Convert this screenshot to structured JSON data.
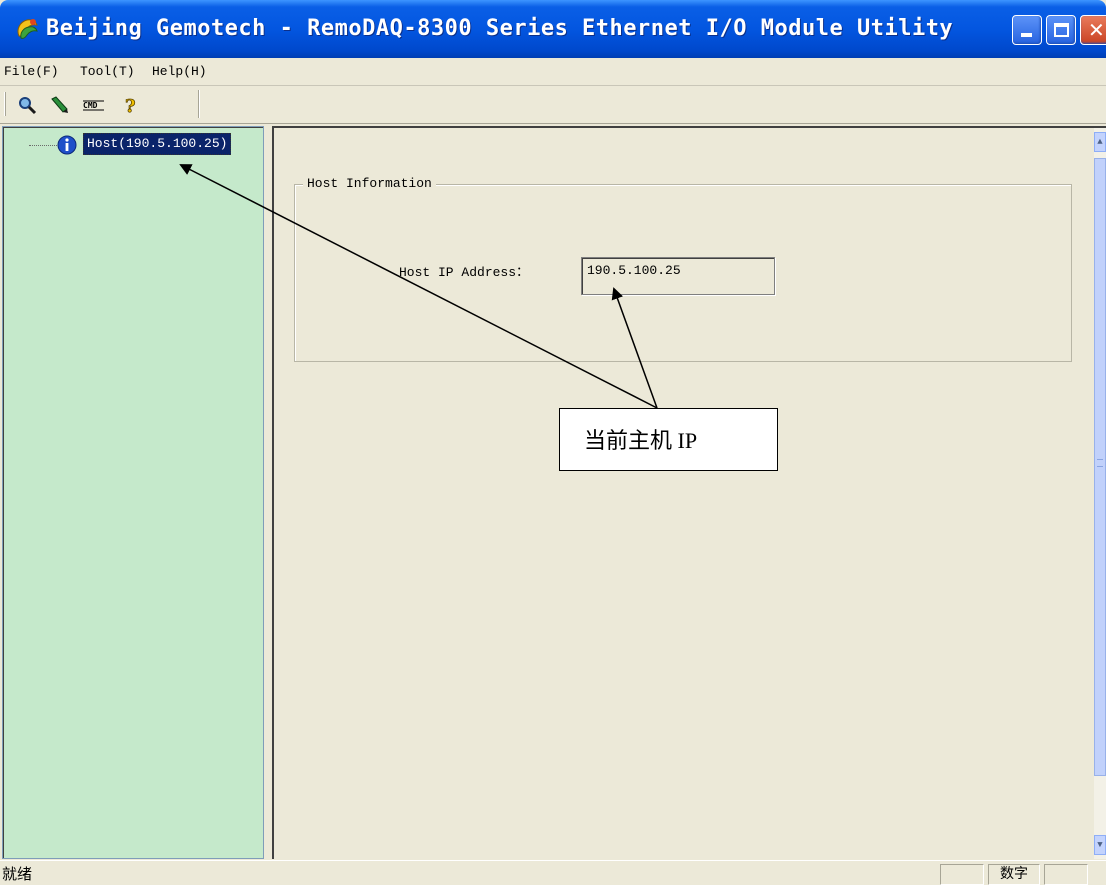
{
  "window": {
    "title": "Beijing Gemotech - RemoDAQ-8300 Series Ethernet I/O Module Utility"
  },
  "menu": {
    "items": [
      {
        "label": "File(F)"
      },
      {
        "label": "Tool(T)"
      },
      {
        "label": "Help(H)"
      }
    ]
  },
  "toolbar": {
    "buttons": [
      {
        "icon": "search-icon"
      },
      {
        "icon": "pencil-icon"
      },
      {
        "icon": "cmd-icon",
        "label": "CMD"
      },
      {
        "icon": "help-icon"
      }
    ]
  },
  "tree": {
    "node_label": "Host(190.5.100.25)",
    "node_icon": "info-icon"
  },
  "host_info": {
    "group_title": "Host Information",
    "ip_label": "Host IP Address：",
    "ip_value": "190.5.100.25"
  },
  "annotation": {
    "text": "当前主机 IP"
  },
  "statusbar": {
    "text": "就绪",
    "num_indicator": "数字"
  },
  "colors": {
    "titlebar": "#0356e0",
    "tree_background": "#c5e9cb",
    "selection": "#0a246a",
    "window_background": "#ece9d8"
  }
}
